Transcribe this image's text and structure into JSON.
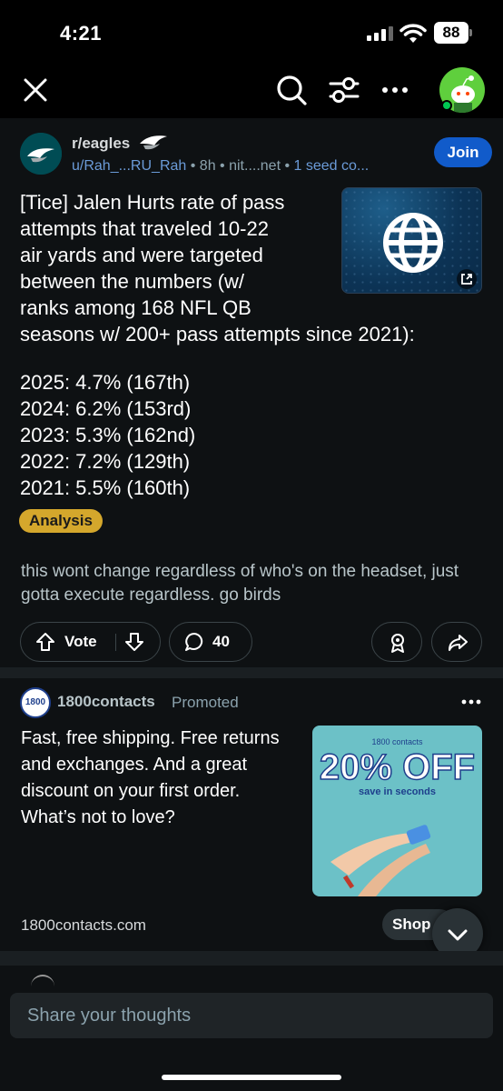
{
  "status_bar": {
    "time": "4:21",
    "battery": "88"
  },
  "post": {
    "subreddit": "r/eagles",
    "author": "u/Rah_...RU_Rah",
    "age": "8h",
    "domain": "nit....net",
    "seed": "1 seed co...",
    "join_label": "Join",
    "title_lines": [
      "[Tice] Jalen Hurts rate of pass",
      "attempts that traveled 10-22",
      "air yards and were targeted",
      "between the numbers (w/",
      "ranks among 168 NFL QB",
      "seasons w/ 200+ pass attempts since 2021):"
    ],
    "stats": [
      "2025: 4.7% (167th)",
      "2024: 6.2% (153rd)",
      "2023: 5.3% (162nd)",
      "2022: 7.2% (129th)",
      "2021: 5.5% (160th)"
    ],
    "flair": "Analysis",
    "flair_color": "#d4a72c",
    "body": "this wont change regardless of who's on the headset, just gotta execute regardless. go birds",
    "vote_label": "Vote",
    "comment_count": "40"
  },
  "ad": {
    "logo_text": "1800",
    "advertiser": "1800contacts",
    "promoted_label": "Promoted",
    "text": "Fast, free shipping. Free returns and exchanges. And a great discount on your first order. What’s not to love?",
    "image_brand": "1800 contacts",
    "image_offer": "20% OFF",
    "image_tagline": "save in seconds",
    "domain": "1800contacts.com",
    "cta_label": "Shop"
  },
  "composer": {
    "placeholder": "Share your thoughts"
  },
  "colors": {
    "join_blue": "#115bca",
    "avatar_green": "#5fcf3d",
    "link_blue": "#6b9bd8"
  }
}
